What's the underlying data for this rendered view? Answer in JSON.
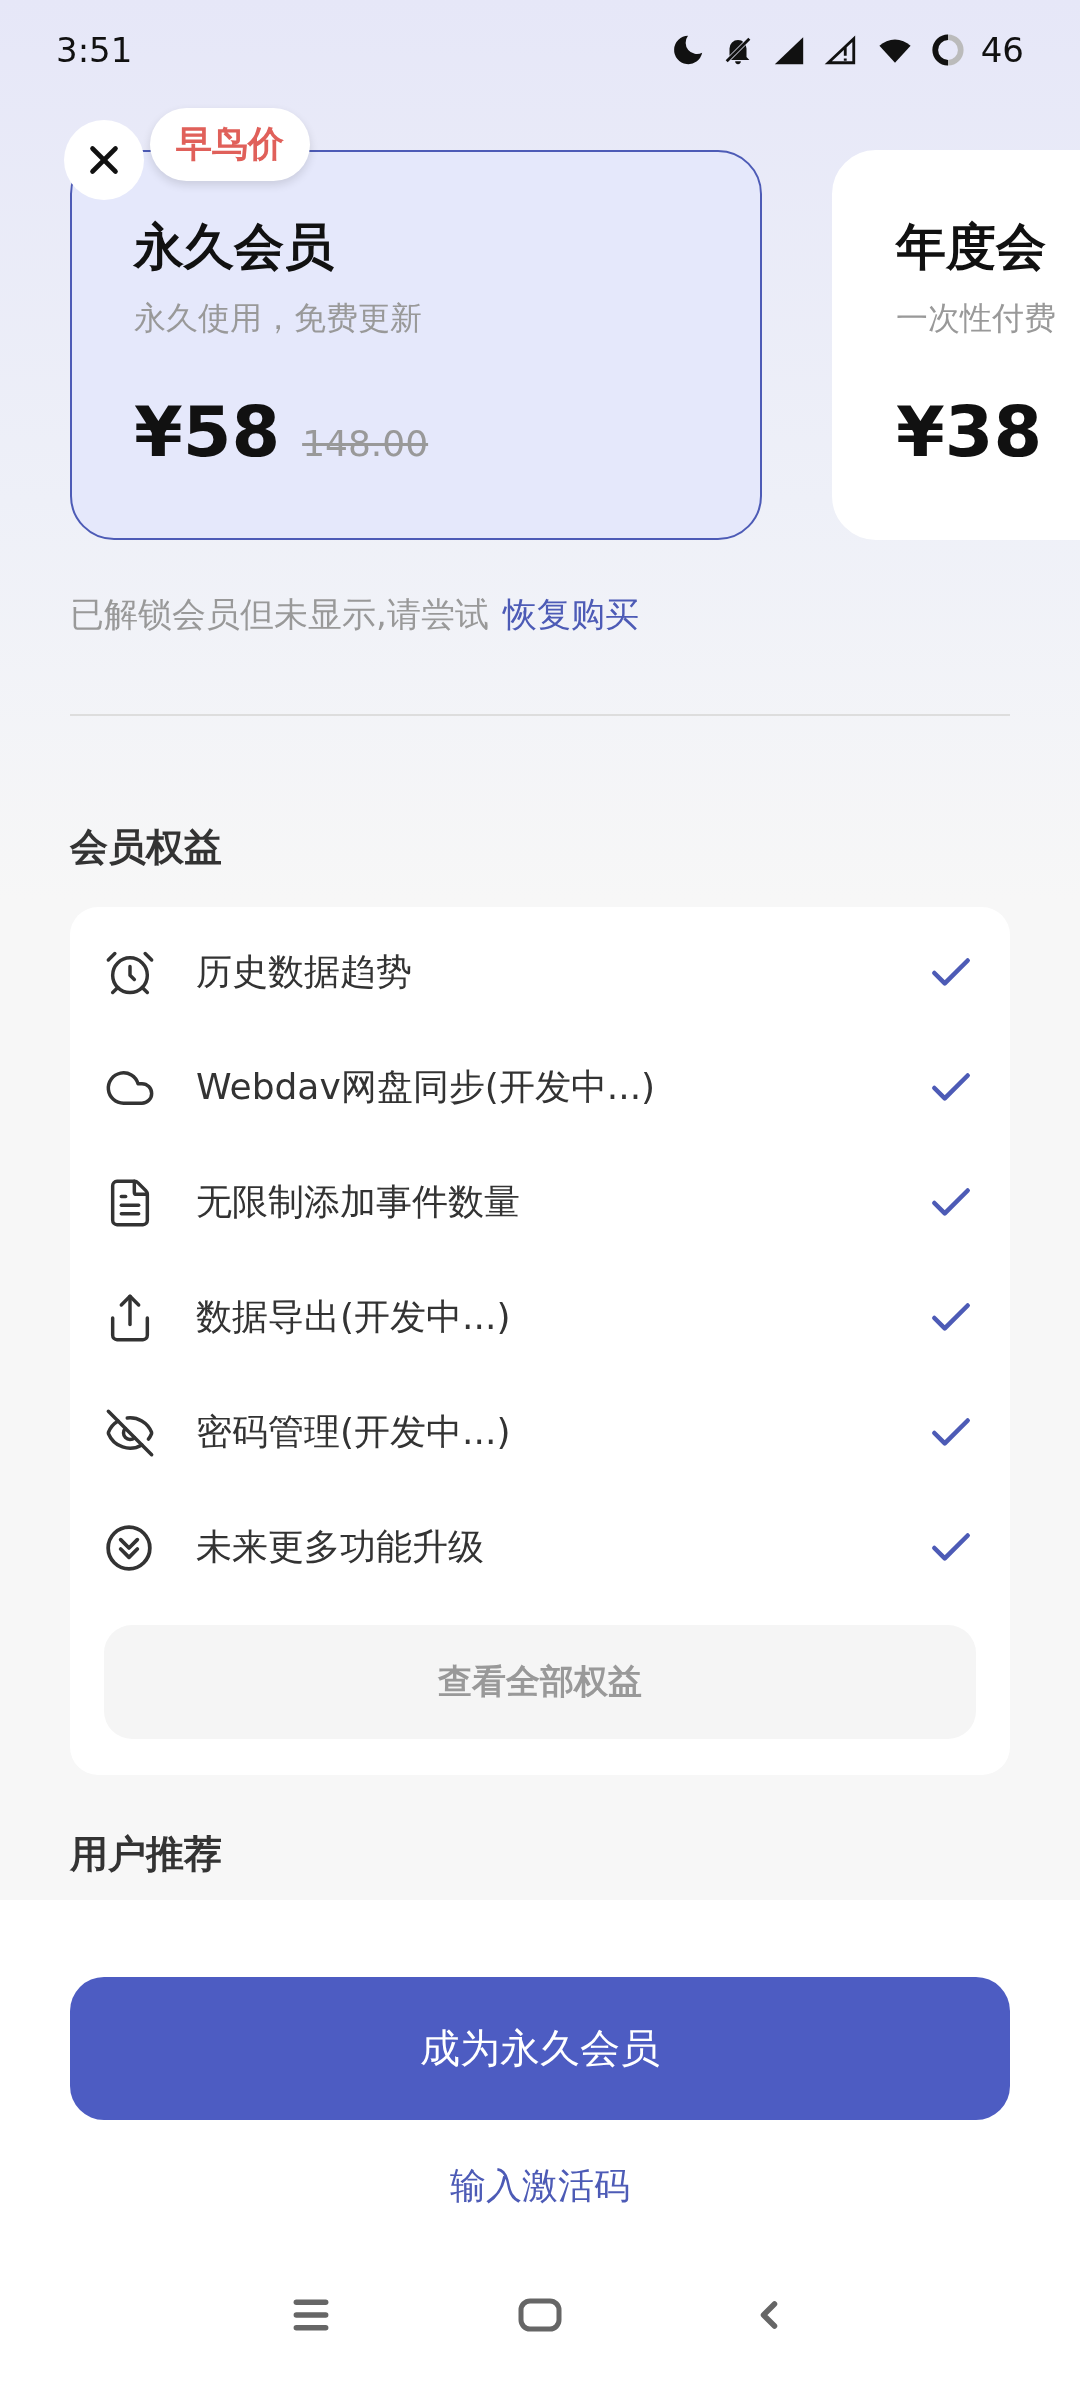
{
  "status_bar": {
    "time": "3:51",
    "battery": "46"
  },
  "plans": [
    {
      "name": "永久会员",
      "desc": "永久使用，免费更新",
      "price": "¥58",
      "original_price": "148.00",
      "badge": "早鸟价",
      "selected": true
    },
    {
      "name": "年度会",
      "desc": "一次性付费",
      "price": "¥38",
      "selected": false
    }
  ],
  "restore": {
    "text": "已解锁会员但未显示,请尝试",
    "link": "恢复购买"
  },
  "benefits": {
    "title": "会员权益",
    "items": [
      "历史数据趋势",
      "Webdav网盘同步(开发中...)",
      "无限制添加事件数量",
      "数据导出(开发中...)",
      "密码管理(开发中...)",
      "未来更多功能升级"
    ],
    "see_all": "查看全部权益"
  },
  "recommend_title": "用户推荐",
  "primary_button": "成为永久会员",
  "activation_link": "输入激活码"
}
